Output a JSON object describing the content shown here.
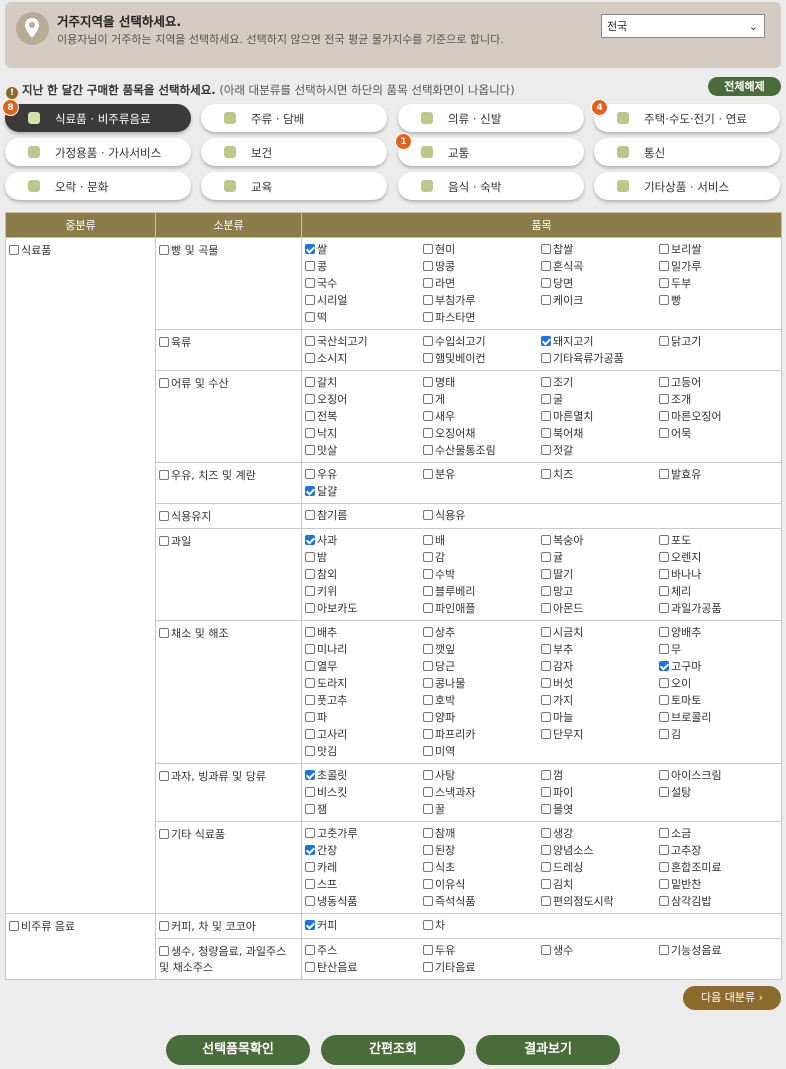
{
  "region": {
    "title": "거주지역을 선택하세요.",
    "desc": "이용자님이 거주하는 지역을 선택하세요. 선택하지 않으면 전국 평균 물가지수를 기준으로 합니다.",
    "selected": "전국"
  },
  "notice": {
    "main": "지난 한 달간 구매한 품목을 선택하세요.",
    "sub": "(아래 대분류를 선택하시면 하단의 품목 선택화면이 나옵니다)"
  },
  "clear_all": "전체해제",
  "categories": [
    {
      "label": "식료품 · 비주류음료",
      "badge": "8",
      "active": true,
      "icon": "apple-icon"
    },
    {
      "label": "주류 · 담배",
      "badge": "",
      "active": false,
      "icon": "wine-glass-icon"
    },
    {
      "label": "의류 · 신발",
      "badge": "",
      "active": false,
      "icon": "shirt-icon"
    },
    {
      "label": "주택·수도·전기 · 연료",
      "badge": "4",
      "active": false,
      "icon": "house-icon"
    },
    {
      "label": "가정용품 · 가사서비스",
      "badge": "",
      "active": false,
      "icon": "furniture-icon"
    },
    {
      "label": "보건",
      "badge": "",
      "active": false,
      "icon": "medical-icon"
    },
    {
      "label": "교통",
      "badge": "1",
      "active": false,
      "icon": "car-icon"
    },
    {
      "label": "통신",
      "badge": "",
      "active": false,
      "icon": "phone-icon"
    },
    {
      "label": "오락 · 문화",
      "badge": "",
      "active": false,
      "icon": "ticket-icon"
    },
    {
      "label": "교육",
      "badge": "",
      "active": false,
      "icon": "book-icon"
    },
    {
      "label": "음식 · 숙박",
      "badge": "",
      "active": false,
      "icon": "bowl-icon"
    },
    {
      "label": "기타상품 · 서비스",
      "badge": "",
      "active": false,
      "icon": "misc-icon"
    }
  ],
  "table": {
    "headers": [
      "중분류",
      "소분류",
      "품목"
    ],
    "groups": [
      {
        "major": "식료품",
        "subs": [
          {
            "name": "빵 및 곡물",
            "items": [
              [
                "쌀",
                true
              ],
              [
                "현미",
                false
              ],
              [
                "찹쌀",
                false
              ],
              [
                "보리쌀",
                false
              ],
              [
                "콩",
                false
              ],
              [
                "땅콩",
                false
              ],
              [
                "혼식곡",
                false
              ],
              [
                "밀가루",
                false
              ],
              [
                "국수",
                false
              ],
              [
                "라면",
                false
              ],
              [
                "당면",
                false
              ],
              [
                "두부",
                false
              ],
              [
                "시리얼",
                false
              ],
              [
                "부침가루",
                false
              ],
              [
                "케이크",
                false
              ],
              [
                "빵",
                false
              ],
              [
                "떡",
                false
              ],
              [
                "파스타면",
                false
              ]
            ]
          },
          {
            "name": "육류",
            "items": [
              [
                "국산쇠고기",
                false
              ],
              [
                "수입쇠고기",
                false
              ],
              [
                "돼지고기",
                true
              ],
              [
                "닭고기",
                false
              ],
              [
                "소시지",
                false
              ],
              [
                "햄및베이컨",
                false
              ],
              [
                "기타육류가공품",
                false
              ]
            ]
          },
          {
            "name": "어류 및 수산",
            "items": [
              [
                "갈치",
                false
              ],
              [
                "명태",
                false
              ],
              [
                "조기",
                false
              ],
              [
                "고등어",
                false
              ],
              [
                "오징어",
                false
              ],
              [
                "게",
                false
              ],
              [
                "굴",
                false
              ],
              [
                "조개",
                false
              ],
              [
                "전복",
                false
              ],
              [
                "새우",
                false
              ],
              [
                "마른멸치",
                false
              ],
              [
                "마른오징어",
                false
              ],
              [
                "낙지",
                false
              ],
              [
                "오징어채",
                false
              ],
              [
                "북어채",
                false
              ],
              [
                "어묵",
                false
              ],
              [
                "맛살",
                false
              ],
              [
                "수산물통조림",
                false
              ],
              [
                "젓갈",
                false
              ]
            ]
          },
          {
            "name": "우유, 치즈 및 계란",
            "items": [
              [
                "우유",
                false
              ],
              [
                "분유",
                false
              ],
              [
                "치즈",
                false
              ],
              [
                "발효유",
                false
              ],
              [
                "달걀",
                true
              ]
            ]
          },
          {
            "name": "식용유지",
            "items": [
              [
                "참기름",
                false
              ],
              [
                "식용유",
                false
              ]
            ]
          },
          {
            "name": "과일",
            "items": [
              [
                "사과",
                true
              ],
              [
                "배",
                false
              ],
              [
                "복숭아",
                false
              ],
              [
                "포도",
                false
              ],
              [
                "밤",
                false
              ],
              [
                "감",
                false
              ],
              [
                "귤",
                false
              ],
              [
                "오렌지",
                false
              ],
              [
                "참외",
                false
              ],
              [
                "수박",
                false
              ],
              [
                "딸기",
                false
              ],
              [
                "바나나",
                false
              ],
              [
                "키위",
                false
              ],
              [
                "블루베리",
                false
              ],
              [
                "망고",
                false
              ],
              [
                "체리",
                false
              ],
              [
                "아보카도",
                false
              ],
              [
                "파인애플",
                false
              ],
              [
                "아몬드",
                false
              ],
              [
                "과일가공품",
                false
              ]
            ]
          },
          {
            "name": "채소 및 해조",
            "items": [
              [
                "배추",
                false
              ],
              [
                "상추",
                false
              ],
              [
                "시금치",
                false
              ],
              [
                "양배추",
                false
              ],
              [
                "미나리",
                false
              ],
              [
                "깻잎",
                false
              ],
              [
                "부추",
                false
              ],
              [
                "무",
                false
              ],
              [
                "열무",
                false
              ],
              [
                "당근",
                false
              ],
              [
                "감자",
                false
              ],
              [
                "고구마",
                true
              ],
              [
                "도라지",
                false
              ],
              [
                "콩나물",
                false
              ],
              [
                "버섯",
                false
              ],
              [
                "오이",
                false
              ],
              [
                "풋고추",
                false
              ],
              [
                "호박",
                false
              ],
              [
                "가지",
                false
              ],
              [
                "토마토",
                false
              ],
              [
                "파",
                false
              ],
              [
                "양파",
                false
              ],
              [
                "마늘",
                false
              ],
              [
                "브로콜리",
                false
              ],
              [
                "고사리",
                false
              ],
              [
                "파프리카",
                false
              ],
              [
                "단무지",
                false
              ],
              [
                "김",
                false
              ],
              [
                "맛김",
                false
              ],
              [
                "미역",
                false
              ]
            ]
          },
          {
            "name": "과자, 빙과류 및 당류",
            "items": [
              [
                "초콜릿",
                true
              ],
              [
                "사탕",
                false
              ],
              [
                "껌",
                false
              ],
              [
                "아이스크림",
                false
              ],
              [
                "비스킷",
                false
              ],
              [
                "스낵과자",
                false
              ],
              [
                "파이",
                false
              ],
              [
                "설탕",
                false
              ],
              [
                "잼",
                false
              ],
              [
                "꿀",
                false
              ],
              [
                "물엿",
                false
              ]
            ]
          },
          {
            "name": "기타 식료품",
            "items": [
              [
                "고춧가루",
                false
              ],
              [
                "참깨",
                false
              ],
              [
                "생강",
                false
              ],
              [
                "소금",
                false
              ],
              [
                "간장",
                true
              ],
              [
                "된장",
                false
              ],
              [
                "양념소스",
                false
              ],
              [
                "고추장",
                false
              ],
              [
                "카레",
                false
              ],
              [
                "식초",
                false
              ],
              [
                "드레싱",
                false
              ],
              [
                "혼합조미료",
                false
              ],
              [
                "스프",
                false
              ],
              [
                "이유식",
                false
              ],
              [
                "김치",
                false
              ],
              [
                "밑반찬",
                false
              ],
              [
                "냉동식품",
                false
              ],
              [
                "즉석식품",
                false
              ],
              [
                "편의점도시락",
                false
              ],
              [
                "삼각김밥",
                false
              ]
            ]
          }
        ]
      },
      {
        "major": "비주류 음료",
        "subs": [
          {
            "name": "커피, 차 및 코코아",
            "items": [
              [
                "커피",
                true
              ],
              [
                "차",
                false
              ]
            ]
          },
          {
            "name": "생수, 청량음료, 과일주스 및 채소주스",
            "items": [
              [
                "주스",
                false
              ],
              [
                "두유",
                false
              ],
              [
                "생수",
                false
              ],
              [
                "기능성음료",
                false
              ],
              [
                "탄산음료",
                false
              ],
              [
                "기타음료",
                false
              ]
            ]
          }
        ]
      }
    ]
  },
  "next_category": "다음 대분류",
  "buttons": {
    "confirm": "선택품목확인",
    "quick": "간편조회",
    "result": "결과보기"
  }
}
